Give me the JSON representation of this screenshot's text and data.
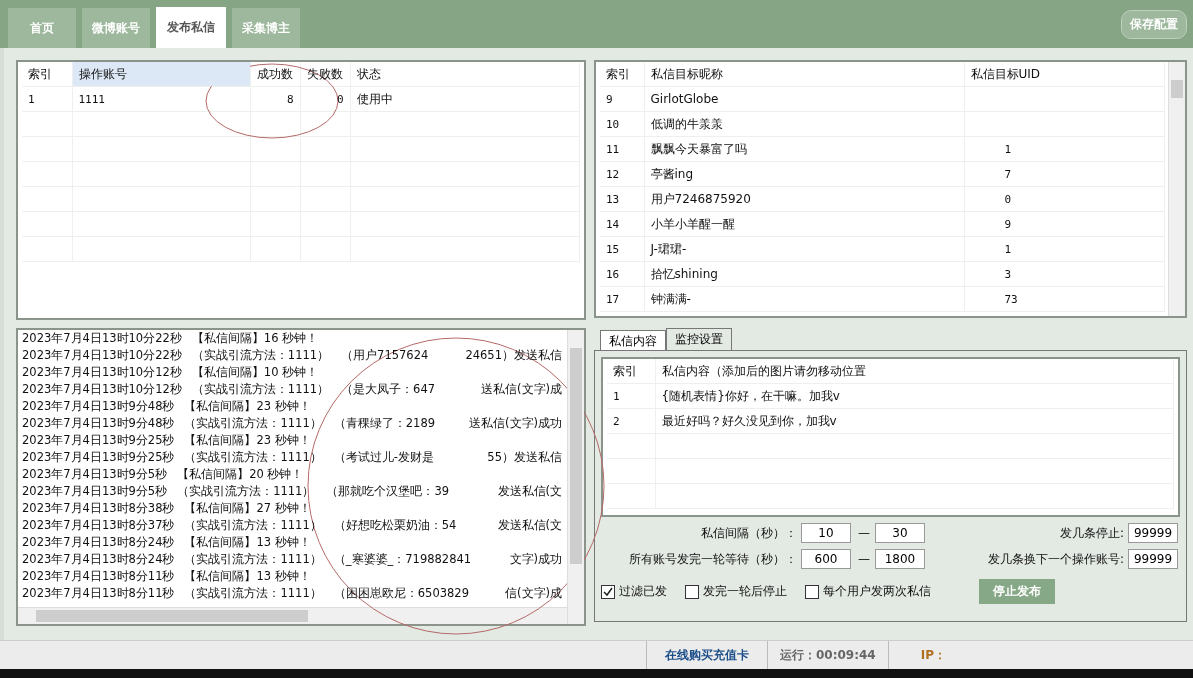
{
  "tabs": [
    {
      "label": "首页",
      "selected": false
    },
    {
      "label": "微博账号",
      "selected": false
    },
    {
      "label": "发布私信",
      "selected": true
    },
    {
      "label": "采集博主",
      "selected": false
    }
  ],
  "save_button": "保存配置",
  "accounts_table": {
    "columns": [
      "索引",
      "操作账号",
      "成功数",
      "失败数",
      "状态"
    ],
    "rows": [
      [
        "1",
        "1111",
        "8",
        "0",
        "使用中"
      ]
    ]
  },
  "targets_table": {
    "columns": [
      "索引",
      "私信目标昵称",
      "私信目标UID"
    ],
    "rows": [
      [
        "9",
        "GirlotGlobe",
        ""
      ],
      [
        "10",
        "低调的牛羕羕",
        ""
      ],
      [
        "11",
        "飘飘今天暴富了吗",
        "1"
      ],
      [
        "12",
        "亭酱ing",
        "7"
      ],
      [
        "13",
        "用户7246875920",
        "0"
      ],
      [
        "14",
        "小羊小羊醒一醒",
        "9"
      ],
      [
        "15",
        "J-珺珺-",
        "1"
      ],
      [
        "16",
        "拾忆shining",
        "3"
      ],
      [
        "17",
        "钟满满-",
        "73"
      ]
    ]
  },
  "log": [
    {
      "time": "2023年7月4日13时10分22秒",
      "message": "【私信间隔】16 秒钟！"
    },
    {
      "time": "2023年7月4日13时10分22秒",
      "message": "（实战引流方法：1111）　（用户7157624",
      "tail": "24651）发送私信"
    },
    {
      "time": "2023年7月4日13时10分12秒",
      "message": "【私信间隔】10 秒钟！"
    },
    {
      "time": "2023年7月4日13时10分12秒",
      "message": "（实战引流方法：1111）　（是大凤子：647",
      "tail": "送私信(文字)成"
    },
    {
      "time": "2023年7月4日13时9分48秒",
      "message": "【私信间隔】23 秒钟！"
    },
    {
      "time": "2023年7月4日13时9分48秒",
      "message": "（实战引流方法：1111）　（青稞绿了：2189",
      "tail": "送私信(文字)成功"
    },
    {
      "time": "2023年7月4日13时9分25秒",
      "message": "【私信间隔】23 秒钟！"
    },
    {
      "time": "2023年7月4日13时9分25秒",
      "message": "（实战引流方法：1111）　（考试过儿-发财是",
      "tail": "55）发送私信"
    },
    {
      "time": "2023年7月4日13时9分5秒",
      "message": "【私信间隔】20 秒钟！"
    },
    {
      "time": "2023年7月4日13时9分5秒",
      "message": "（实战引流方法：1111）　（那就吃个汉堡吧：39",
      "tail": "发送私信(文"
    },
    {
      "time": "2023年7月4日13时8分38秒",
      "message": "【私信间隔】27 秒钟！"
    },
    {
      "time": "2023年7月4日13时8分37秒",
      "message": "（实战引流方法：1111）　（好想吃松栗奶油：54",
      "tail": "发送私信(文"
    },
    {
      "time": "2023年7月4日13时8分24秒",
      "message": "【私信间隔】13 秒钟！"
    },
    {
      "time": "2023年7月4日13时8分24秒",
      "message": "（实战引流方法：1111）　（_寒婆婆_：719882841",
      "tail": "文字)成功"
    },
    {
      "time": "2023年7月4日13时8分11秒",
      "message": "【私信间隔】13 秒钟！"
    },
    {
      "time": "2023年7月4日13时8分11秒",
      "message": "（实战引流方法：1111）　（困困崽欧尼：6503829",
      "tail": "信(文字)成"
    }
  ],
  "sub_tabs": [
    {
      "label": "私信内容",
      "selected": true
    },
    {
      "label": "监控设置",
      "selected": false
    }
  ],
  "messages_table": {
    "columns": [
      "索引",
      "私信内容（添加后的图片请勿移动位置"
    ],
    "rows": [
      [
        "1",
        "{随机表情}你好，在干嘛。加我v"
      ],
      [
        "2",
        "最近好吗？好久没见到你，加我v"
      ]
    ]
  },
  "settings": {
    "interval_label": "私信间隔（秒）：",
    "interval_min": "10",
    "interval_max": "30",
    "separator": "—",
    "round_wait_label": "所有账号发完一轮等待（秒）：",
    "round_wait_min": "600",
    "round_wait_max": "1800",
    "stop_after_label": "发几条停止:",
    "stop_after": "99999",
    "switch_after_label": "发几条换下一个操作账号:",
    "switch_after": "99999"
  },
  "options": [
    {
      "label": "过滤已发",
      "checked": true
    },
    {
      "label": "发完一轮后停止",
      "checked": false
    },
    {
      "label": "每个用户发两次私信",
      "checked": false
    }
  ],
  "stop_button": "停止发布",
  "status_bar": {
    "buy_link": "在线购买充值卡",
    "runtime": "运行：00:09:44",
    "ip_label": "IP："
  }
}
